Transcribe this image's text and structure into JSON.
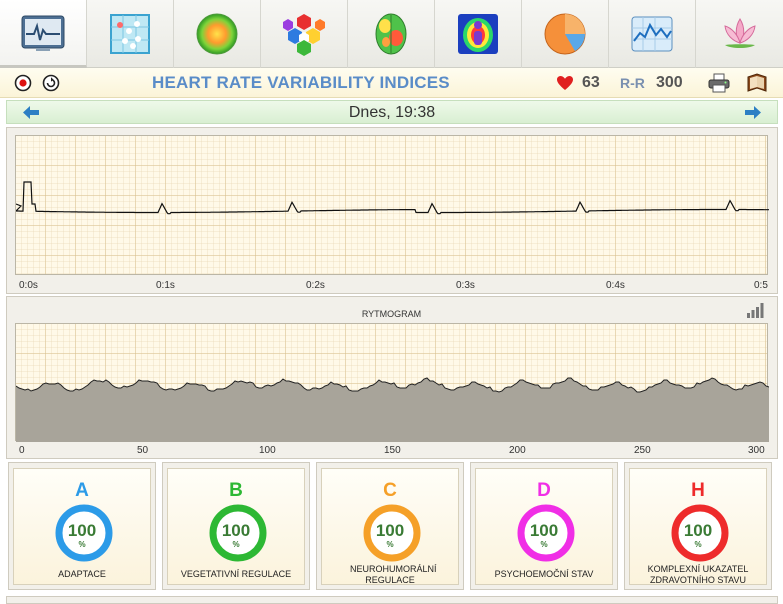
{
  "toolbar": {
    "items": [
      {
        "name": "hrv-monitor",
        "active": true
      },
      {
        "name": "scatter-grid",
        "active": false
      },
      {
        "name": "energy-sphere",
        "active": false
      },
      {
        "name": "hexagon-chakras",
        "active": false
      },
      {
        "name": "brain-map",
        "active": false
      },
      {
        "name": "aura-scan",
        "active": false
      },
      {
        "name": "pie-chart",
        "active": false
      },
      {
        "name": "line-chart",
        "active": false
      },
      {
        "name": "lotus",
        "active": false
      }
    ]
  },
  "header": {
    "title": "HEART RATE VARIABILITY INDICES",
    "heart_rate": "63",
    "rr_label": "R-R",
    "rr_value": "300"
  },
  "date_nav": {
    "label": "Dnes, 19:38"
  },
  "ecg": {
    "x_ticks": [
      "0:0s",
      "0:1s",
      "0:2s",
      "0:3s",
      "0:4s",
      "0:5"
    ]
  },
  "rhythmogram": {
    "title": "RYTMOGRAM",
    "x_ticks": [
      "0",
      "50",
      "100",
      "150",
      "200",
      "250",
      "300"
    ]
  },
  "indices": [
    {
      "letter": "A",
      "value": "100",
      "unit": "%",
      "label": "ADAPTACE",
      "color": "#2c9be8"
    },
    {
      "letter": "B",
      "value": "100",
      "unit": "%",
      "label": "VEGETATIVNÍ REGULACE",
      "color": "#2db834"
    },
    {
      "letter": "C",
      "value": "100",
      "unit": "%",
      "label": "NEUROHUMORÁLNÍ REGULACE",
      "color": "#f5a028"
    },
    {
      "letter": "D",
      "value": "100",
      "unit": "%",
      "label": "PSYCHOEMOČNÍ STAV",
      "color": "#f02ee6"
    },
    {
      "letter": "H",
      "value": "100",
      "unit": "%",
      "label": "KOMPLEXNÍ UKAZATEL ZDRAVOTNÍHO STAVU",
      "color": "#ee2b2b"
    }
  ]
}
